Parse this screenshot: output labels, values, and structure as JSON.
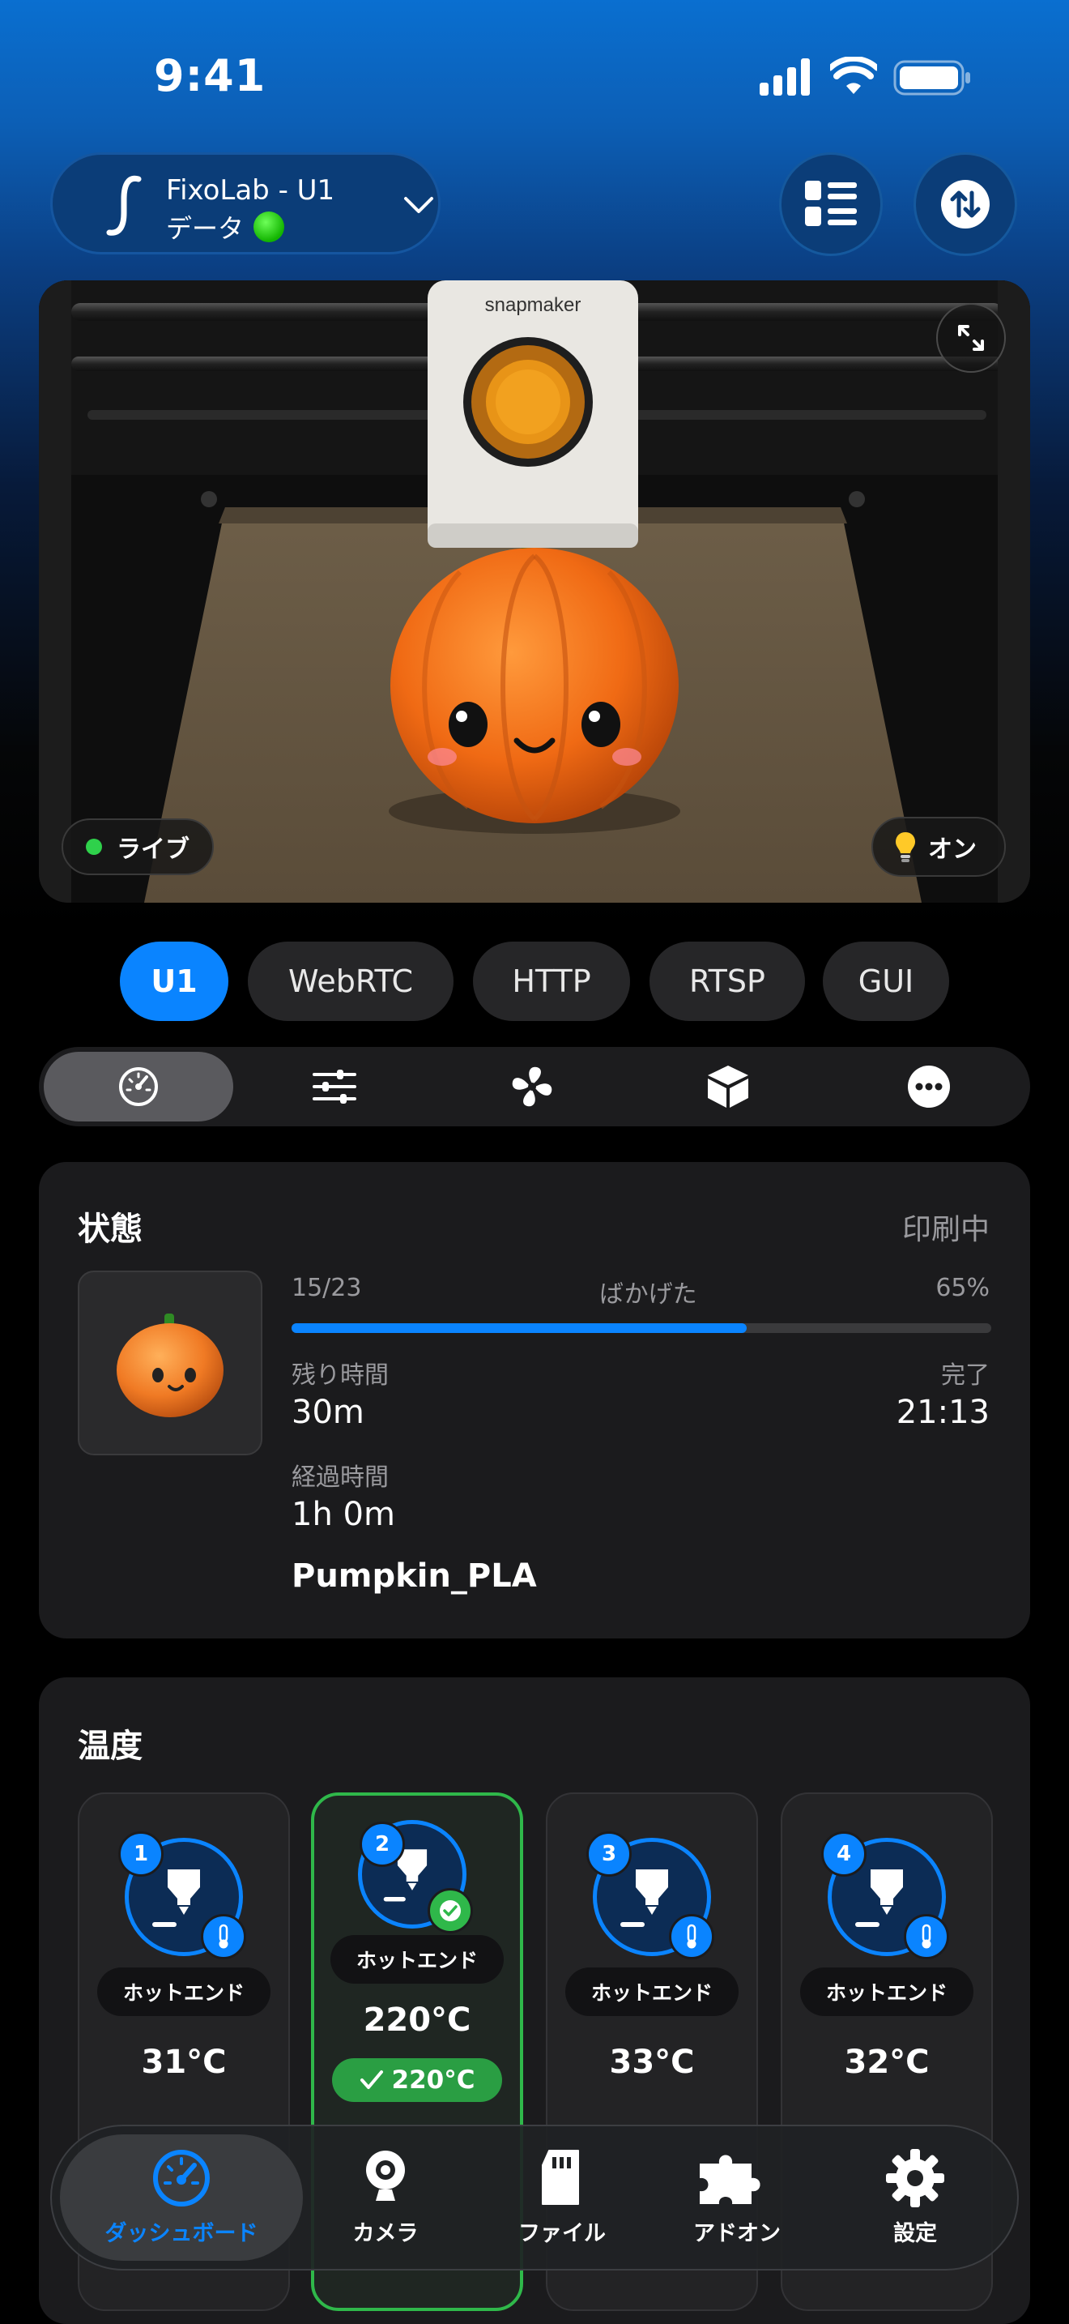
{
  "status_bar": {
    "time": "9:41"
  },
  "header": {
    "printer_name": "FixoLab - U1",
    "printer_sub": "データ",
    "icons": [
      "list-icon",
      "sort-arrows-icon",
      "chevron-down-icon"
    ]
  },
  "camera": {
    "live_label": "ライブ",
    "light_label": "オン",
    "brand_on_toolhead": "snapmaker"
  },
  "stream_tabs": [
    {
      "label": "U1",
      "active": true
    },
    {
      "label": "WebRTC",
      "active": false
    },
    {
      "label": "HTTP",
      "active": false
    },
    {
      "label": "RTSP",
      "active": false
    },
    {
      "label": "GUI",
      "active": false
    }
  ],
  "segments": [
    "gauge-icon",
    "sliders-icon",
    "fan-icon",
    "box-icon",
    "more-icon"
  ],
  "status": {
    "title": "状態",
    "state": "印刷中",
    "layer": "15/23",
    "mode": "ばかげた",
    "percent": "65%",
    "progress": 0.65,
    "remaining_label": "残り時間",
    "remaining_value": "30m",
    "finish_label": "完了",
    "finish_value": "21:13",
    "elapsed_label": "経過時間",
    "elapsed_value": "1h 0m",
    "file_name": "Pumpkin_PLA"
  },
  "temperature": {
    "title": "温度",
    "hotends": [
      {
        "num": "1",
        "label": "ホットエンド",
        "temp": "31°C",
        "selected": false
      },
      {
        "num": "2",
        "label": "ホットエンド",
        "temp": "220°C",
        "target": "220°C",
        "selected": true
      },
      {
        "num": "3",
        "label": "ホットエンド",
        "temp": "33°C",
        "selected": false
      },
      {
        "num": "4",
        "label": "ホットエンド",
        "temp": "32°C",
        "selected": false
      }
    ]
  },
  "tabbar": [
    {
      "label": "ダッシュボード",
      "icon": "dashboard-icon",
      "active": true
    },
    {
      "label": "カメラ",
      "icon": "webcam-icon",
      "active": false
    },
    {
      "label": "ファイル",
      "icon": "sd-card-icon",
      "active": false
    },
    {
      "label": "アドオン",
      "icon": "puzzle-icon",
      "active": false
    },
    {
      "label": "設定",
      "icon": "gear-icon",
      "active": false
    }
  ],
  "colors": {
    "accent": "#0a84ff",
    "success": "#2fb84a",
    "card": "#1b1b1d"
  }
}
